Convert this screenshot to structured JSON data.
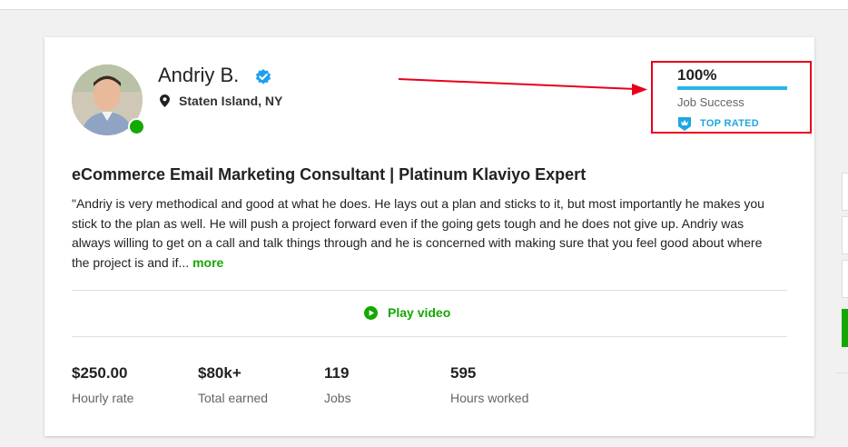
{
  "profile": {
    "name": "Andriy B.",
    "location": "Staten Island, NY",
    "title": "eCommerce Email Marketing Consultant | Platinum Klaviyo Expert",
    "description": "\"Andriy is very methodical and good at what he does. He lays out a plan and sticks to it, but most importantly he makes you stick to the plan as well. He will push a project forward even if the going gets tough and he does not give up. Andriy was always willing to get on a call and talk things through and he is concerned with making sure that you feel good about where the project is and if...",
    "more_label": "more",
    "play_video_label": "Play video"
  },
  "job_success": {
    "percent_label": "100%",
    "percent_value": 100,
    "label": "Job Success",
    "badge": "TOP RATED"
  },
  "stats": [
    {
      "value": "$250.00",
      "label": "Hourly rate"
    },
    {
      "value": "$80k+",
      "label": "Total earned"
    },
    {
      "value": "119",
      "label": "Jobs"
    },
    {
      "value": "595",
      "label": "Hours worked"
    }
  ],
  "colors": {
    "accent_green": "#14a800",
    "highlight_red": "#e8001b",
    "top_rated_blue": "#1fa6e0",
    "progress_blue": "#29b6e8"
  },
  "icons": {
    "verified": "verified-badge-icon",
    "location": "map-pin-icon",
    "top_rated": "top-rated-badge-icon",
    "play": "play-circle-icon"
  }
}
